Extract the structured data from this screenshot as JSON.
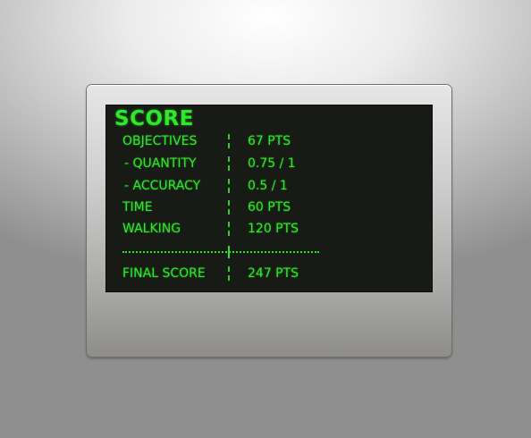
{
  "panel": {
    "title": "SCORE",
    "rows": [
      {
        "label": "OBJECTIVES",
        "value": "67 PTS"
      },
      {
        "label": "- QUANTITY",
        "value": "0.75 / 1"
      },
      {
        "label": "- ACCURACY",
        "value": "0.5 / 1"
      },
      {
        "label": "TIME",
        "value": "60 PTS"
      },
      {
        "label": "WALKING",
        "value": "120 PTS"
      }
    ],
    "final": {
      "label": "FINAL SCORE",
      "value": "247 PTS"
    }
  },
  "colors": {
    "screen_background": "#171a15",
    "text_green": "#2ee82a",
    "device_frame": "#c8c8c8"
  }
}
